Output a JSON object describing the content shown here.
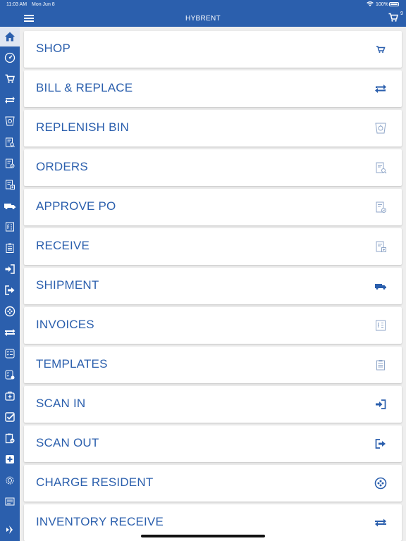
{
  "status_bar": {
    "time": "11:03 AM",
    "date": "Mon Jun 8",
    "battery": "100%"
  },
  "header": {
    "title": "HYBRENT",
    "cart_count": "9"
  },
  "sidebar": {
    "items": [
      "home-icon",
      "dashboard-icon",
      "cart-icon",
      "bill-replace-icon",
      "replenish-bin-icon",
      "orders-icon",
      "approve-po-icon",
      "receive-icon",
      "shipment-icon",
      "invoices-icon",
      "templates-icon",
      "scan-in-icon",
      "scan-out-icon",
      "charge-resident-icon",
      "inventory-receive-icon",
      "checklist-icon",
      "checklist-approve-icon",
      "medical-kit-icon",
      "checkbox-icon",
      "clipboard-check-icon",
      "add-icon",
      "settings-icon",
      "report-icon",
      "collapse-icon"
    ]
  },
  "menu": [
    {
      "label": "SHOP",
      "icon": "cart-icon"
    },
    {
      "label": "BILL & REPLACE",
      "icon": "bill-replace-icon"
    },
    {
      "label": "REPLENISH BIN",
      "icon": "replenish-bin-icon"
    },
    {
      "label": "ORDERS",
      "icon": "orders-icon"
    },
    {
      "label": "APPROVE PO",
      "icon": "approve-po-icon"
    },
    {
      "label": "RECEIVE",
      "icon": "receive-icon"
    },
    {
      "label": "SHIPMENT",
      "icon": "truck-icon"
    },
    {
      "label": "INVOICES",
      "icon": "invoices-icon"
    },
    {
      "label": "TEMPLATES",
      "icon": "templates-icon"
    },
    {
      "label": "SCAN IN",
      "icon": "scan-in-icon"
    },
    {
      "label": "SCAN OUT",
      "icon": "scan-out-icon"
    },
    {
      "label": "CHARGE RESIDENT",
      "icon": "charge-resident-icon"
    },
    {
      "label": "INVENTORY RECEIVE",
      "icon": "inventory-receive-icon"
    }
  ],
  "colors": {
    "brand": "#2b5fad",
    "background": "#eeeeee",
    "card": "#ffffff"
  }
}
